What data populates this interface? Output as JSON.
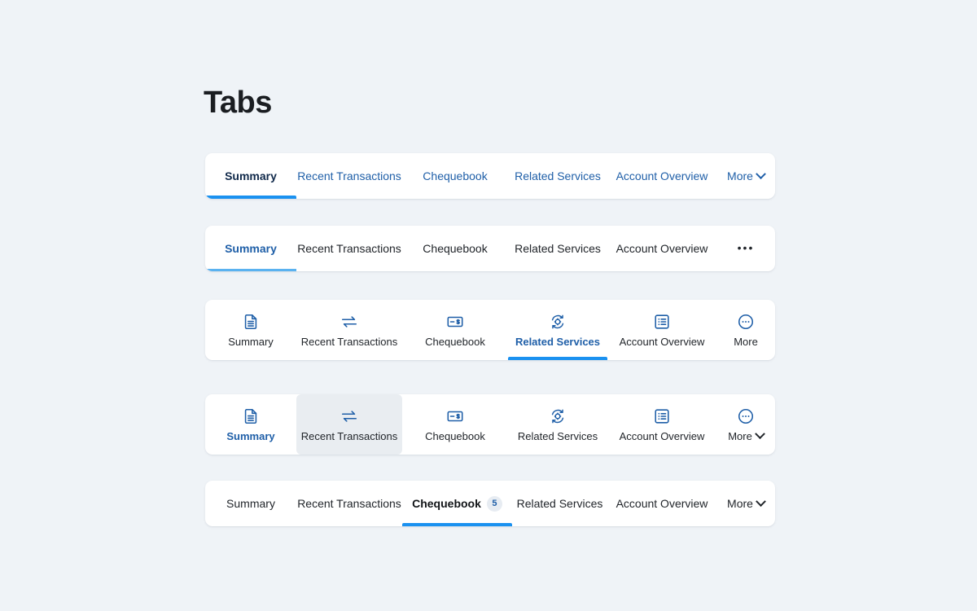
{
  "page": {
    "title": "Tabs",
    "background_color": "#eff3f7"
  },
  "colors": {
    "accent_blue": "#1a91f0",
    "link_blue": "#1f5fa8",
    "active_navy": "#10294a",
    "text_dark": "#22262b",
    "hover_grey": "#e9edf1",
    "badge_bg": "#e7ecf2",
    "card_white": "#ffffff"
  },
  "tabbars": [
    {
      "id": "bar1",
      "variant": "text-links-blue",
      "overflow_control": {
        "label": "More",
        "icon": "chevron-down-icon"
      },
      "tabs": [
        {
          "label": "Summary",
          "active": true
        },
        {
          "label": "Recent Transactions",
          "active": false
        },
        {
          "label": "Chequebook",
          "active": false
        },
        {
          "label": "Related Services",
          "active": false
        },
        {
          "label": "Account Overview",
          "active": false
        }
      ]
    },
    {
      "id": "bar2",
      "variant": "text-links-dark",
      "overflow_control": {
        "label": "•••",
        "icon": "ellipsis-icon"
      },
      "tabs": [
        {
          "label": "Summary",
          "active": true
        },
        {
          "label": "Recent Transactions",
          "active": false
        },
        {
          "label": "Chequebook",
          "active": false
        },
        {
          "label": "Related Services",
          "active": false
        },
        {
          "label": "Account Overview",
          "active": false
        }
      ]
    },
    {
      "id": "bar3",
      "variant": "icon-tabs",
      "tabs": [
        {
          "label": "Summary",
          "icon": "document-icon",
          "active": false
        },
        {
          "label": "Recent Transactions",
          "icon": "transfer-arrows-icon",
          "active": false
        },
        {
          "label": "Chequebook",
          "icon": "cheque-dollar-icon",
          "active": false
        },
        {
          "label": "Related Services",
          "icon": "gear-refresh-icon",
          "active": true
        },
        {
          "label": "Account Overview",
          "icon": "list-icon",
          "active": false
        },
        {
          "label": "More",
          "icon": "circle-ellipsis-icon",
          "active": false
        }
      ]
    },
    {
      "id": "bar4",
      "variant": "icon-tabs-hover",
      "tabs": [
        {
          "label": "Summary",
          "icon": "document-icon",
          "active": true
        },
        {
          "label": "Recent Transactions",
          "icon": "transfer-arrows-icon",
          "active": false,
          "hover": true
        },
        {
          "label": "Chequebook",
          "icon": "cheque-dollar-icon",
          "active": false
        },
        {
          "label": "Related Services",
          "icon": "gear-refresh-icon",
          "active": false
        },
        {
          "label": "Account Overview",
          "icon": "list-icon",
          "active": false
        },
        {
          "label": "More",
          "icon": "circle-ellipsis-icon",
          "active": false,
          "has_chevron": true
        }
      ]
    },
    {
      "id": "bar5",
      "variant": "text-links-badge",
      "overflow_control": {
        "label": "More",
        "icon": "chevron-down-icon"
      },
      "tabs": [
        {
          "label": "Summary",
          "active": false
        },
        {
          "label": "Recent Transactions",
          "active": false
        },
        {
          "label": "Chequebook",
          "active": true,
          "badge": "5"
        },
        {
          "label": "Related Services",
          "active": false
        },
        {
          "label": "Account Overview",
          "active": false
        }
      ]
    }
  ]
}
